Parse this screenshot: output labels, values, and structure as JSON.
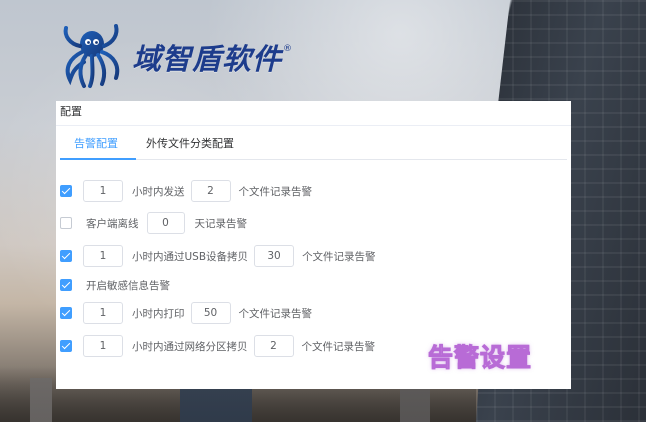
{
  "brand": {
    "name": "域智盾软件",
    "reg": "®"
  },
  "panel": {
    "title": "配置",
    "tabs": [
      {
        "label": "告警配置",
        "active": true
      },
      {
        "label": "外传文件分类配置",
        "active": false
      }
    ]
  },
  "rules": [
    {
      "checked": true,
      "value1": "1",
      "text1": "小时内发送",
      "value2": "2",
      "text2": "个文件记录告警"
    },
    {
      "checked": false,
      "text0": "客户端离线",
      "value1": "0",
      "text1": "天记录告警"
    },
    {
      "checked": true,
      "value1": "1",
      "text1": "小时内通过USB设备拷贝",
      "value2": "30",
      "text2": "个文件记录告警"
    },
    {
      "checked": true,
      "text0": "开启敏感信息告警"
    },
    {
      "checked": true,
      "value1": "1",
      "text1": "小时内打印",
      "value2": "50",
      "text2": "个文件记录告警"
    },
    {
      "checked": true,
      "value1": "1",
      "text1": "小时内通过网络分区拷贝",
      "value2": "2",
      "text2": "个文件记录告警"
    }
  ],
  "overlay": {
    "caption": "告警设置"
  },
  "colors": {
    "accent": "#409eff",
    "brand": "#1d3c8c",
    "caption_stroke": "#b86bd6"
  }
}
